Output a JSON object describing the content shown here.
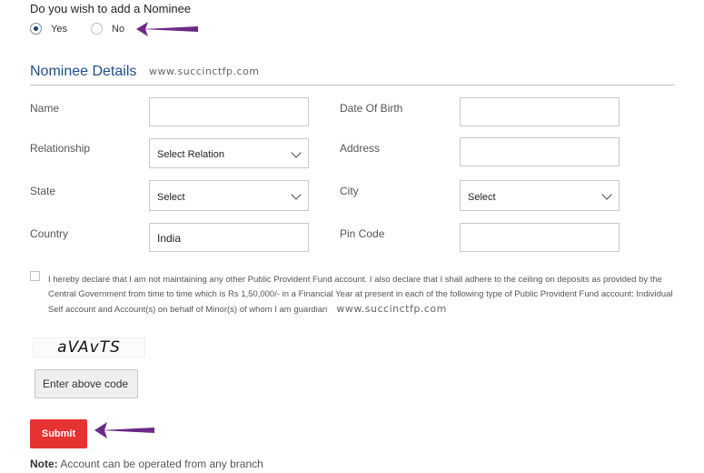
{
  "nominee": {
    "question": "Do you wish to add a Nominee",
    "options": [
      {
        "label": "Yes",
        "checked": true
      },
      {
        "label": "No",
        "checked": false
      }
    ]
  },
  "section": {
    "title": "Nominee Details",
    "watermark": "www.succinctfp.com"
  },
  "form": {
    "name": {
      "label": "Name",
      "value": ""
    },
    "dob": {
      "label": "Date Of Birth",
      "value": ""
    },
    "relationship": {
      "label": "Relationship",
      "value": "Select Relation"
    },
    "address": {
      "label": "Address",
      "value": ""
    },
    "state": {
      "label": "State",
      "value": "Select"
    },
    "city": {
      "label": "City",
      "value": "Select"
    },
    "country": {
      "label": "Country",
      "value": "India"
    },
    "pincode": {
      "label": "Pin Code",
      "value": ""
    }
  },
  "declaration": {
    "checked": false,
    "text": "I hereby declare that I am not maintaining any other Public Provident Fund account. I also declare that I shall adhere to the ceiling on deposits as provided by the Central Government from time to time which is Rs 1,50,000/- in a Financial Year at present in each of the following type of Public Provident Fund account: Individual Self account and Account(s) on behalf of Minor(s) of whom I am guardian",
    "watermark": "www.succinctfp.com"
  },
  "captcha": {
    "code": "aVAvTS",
    "placeholder": "Enter above code"
  },
  "submit_label": "Submit",
  "note": {
    "prefix": "Note:",
    "text": " Account can be operated from any branch"
  },
  "colors": {
    "accent": "#1f4e8a",
    "submit": "#e53232",
    "arrow": "#6b2a86"
  },
  "icons": [
    "arrow-left-icon",
    "chevron-down-icon"
  ]
}
